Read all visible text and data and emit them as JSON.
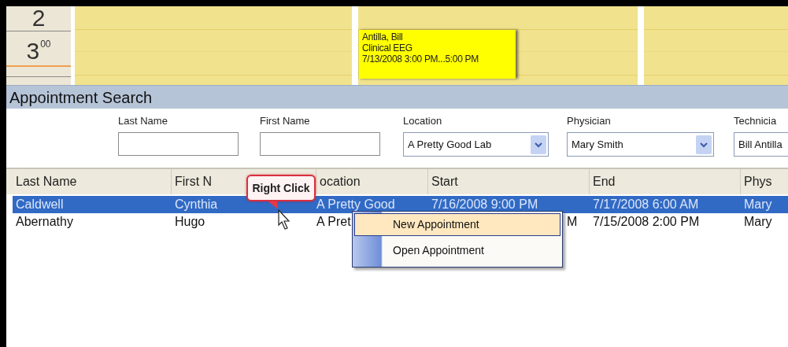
{
  "calendar": {
    "times": [
      {
        "hour": "2"
      },
      {
        "hour": "3",
        "minutes": "00"
      }
    ],
    "appointment": {
      "lines": [
        "Antilla, Bill",
        "Clinical EEG",
        "7/13/2008 3:00 PM...5:00 PM"
      ]
    }
  },
  "search": {
    "title": "Appointment Search",
    "filters": [
      {
        "kind": "text",
        "label": "Last Name"
      },
      {
        "kind": "text",
        "label": "First Name"
      },
      {
        "kind": "dropdown",
        "label": "Location",
        "value": "A Pretty Good Lab"
      },
      {
        "kind": "dropdown",
        "label": "Physician",
        "value": "Mary Smith"
      },
      {
        "kind": "dropdown",
        "label": "Technicia",
        "value": "Bill Antilla"
      }
    ]
  },
  "table": {
    "columns": [
      "Last Name",
      "First N",
      "ocation",
      "Start",
      "End",
      "Phys"
    ],
    "rows": [
      {
        "selected": true,
        "cells": [
          "Caldwell",
          "Cynthia",
          "A Pretty Good",
          "7/16/2008 9:00 PM",
          "7/17/2008 6:00 AM",
          "Mary"
        ]
      },
      {
        "selected": false,
        "cells": [
          "Abernathy",
          "Hugo",
          "A Pret",
          "M",
          "7/15/2008 2:00 PM",
          "Mary"
        ]
      }
    ]
  },
  "callout": {
    "text": "Right Click"
  },
  "context_menu": {
    "items": [
      {
        "label": "New Appointment",
        "selected": true
      },
      {
        "label": "Open Appointment",
        "selected": false
      }
    ]
  }
}
